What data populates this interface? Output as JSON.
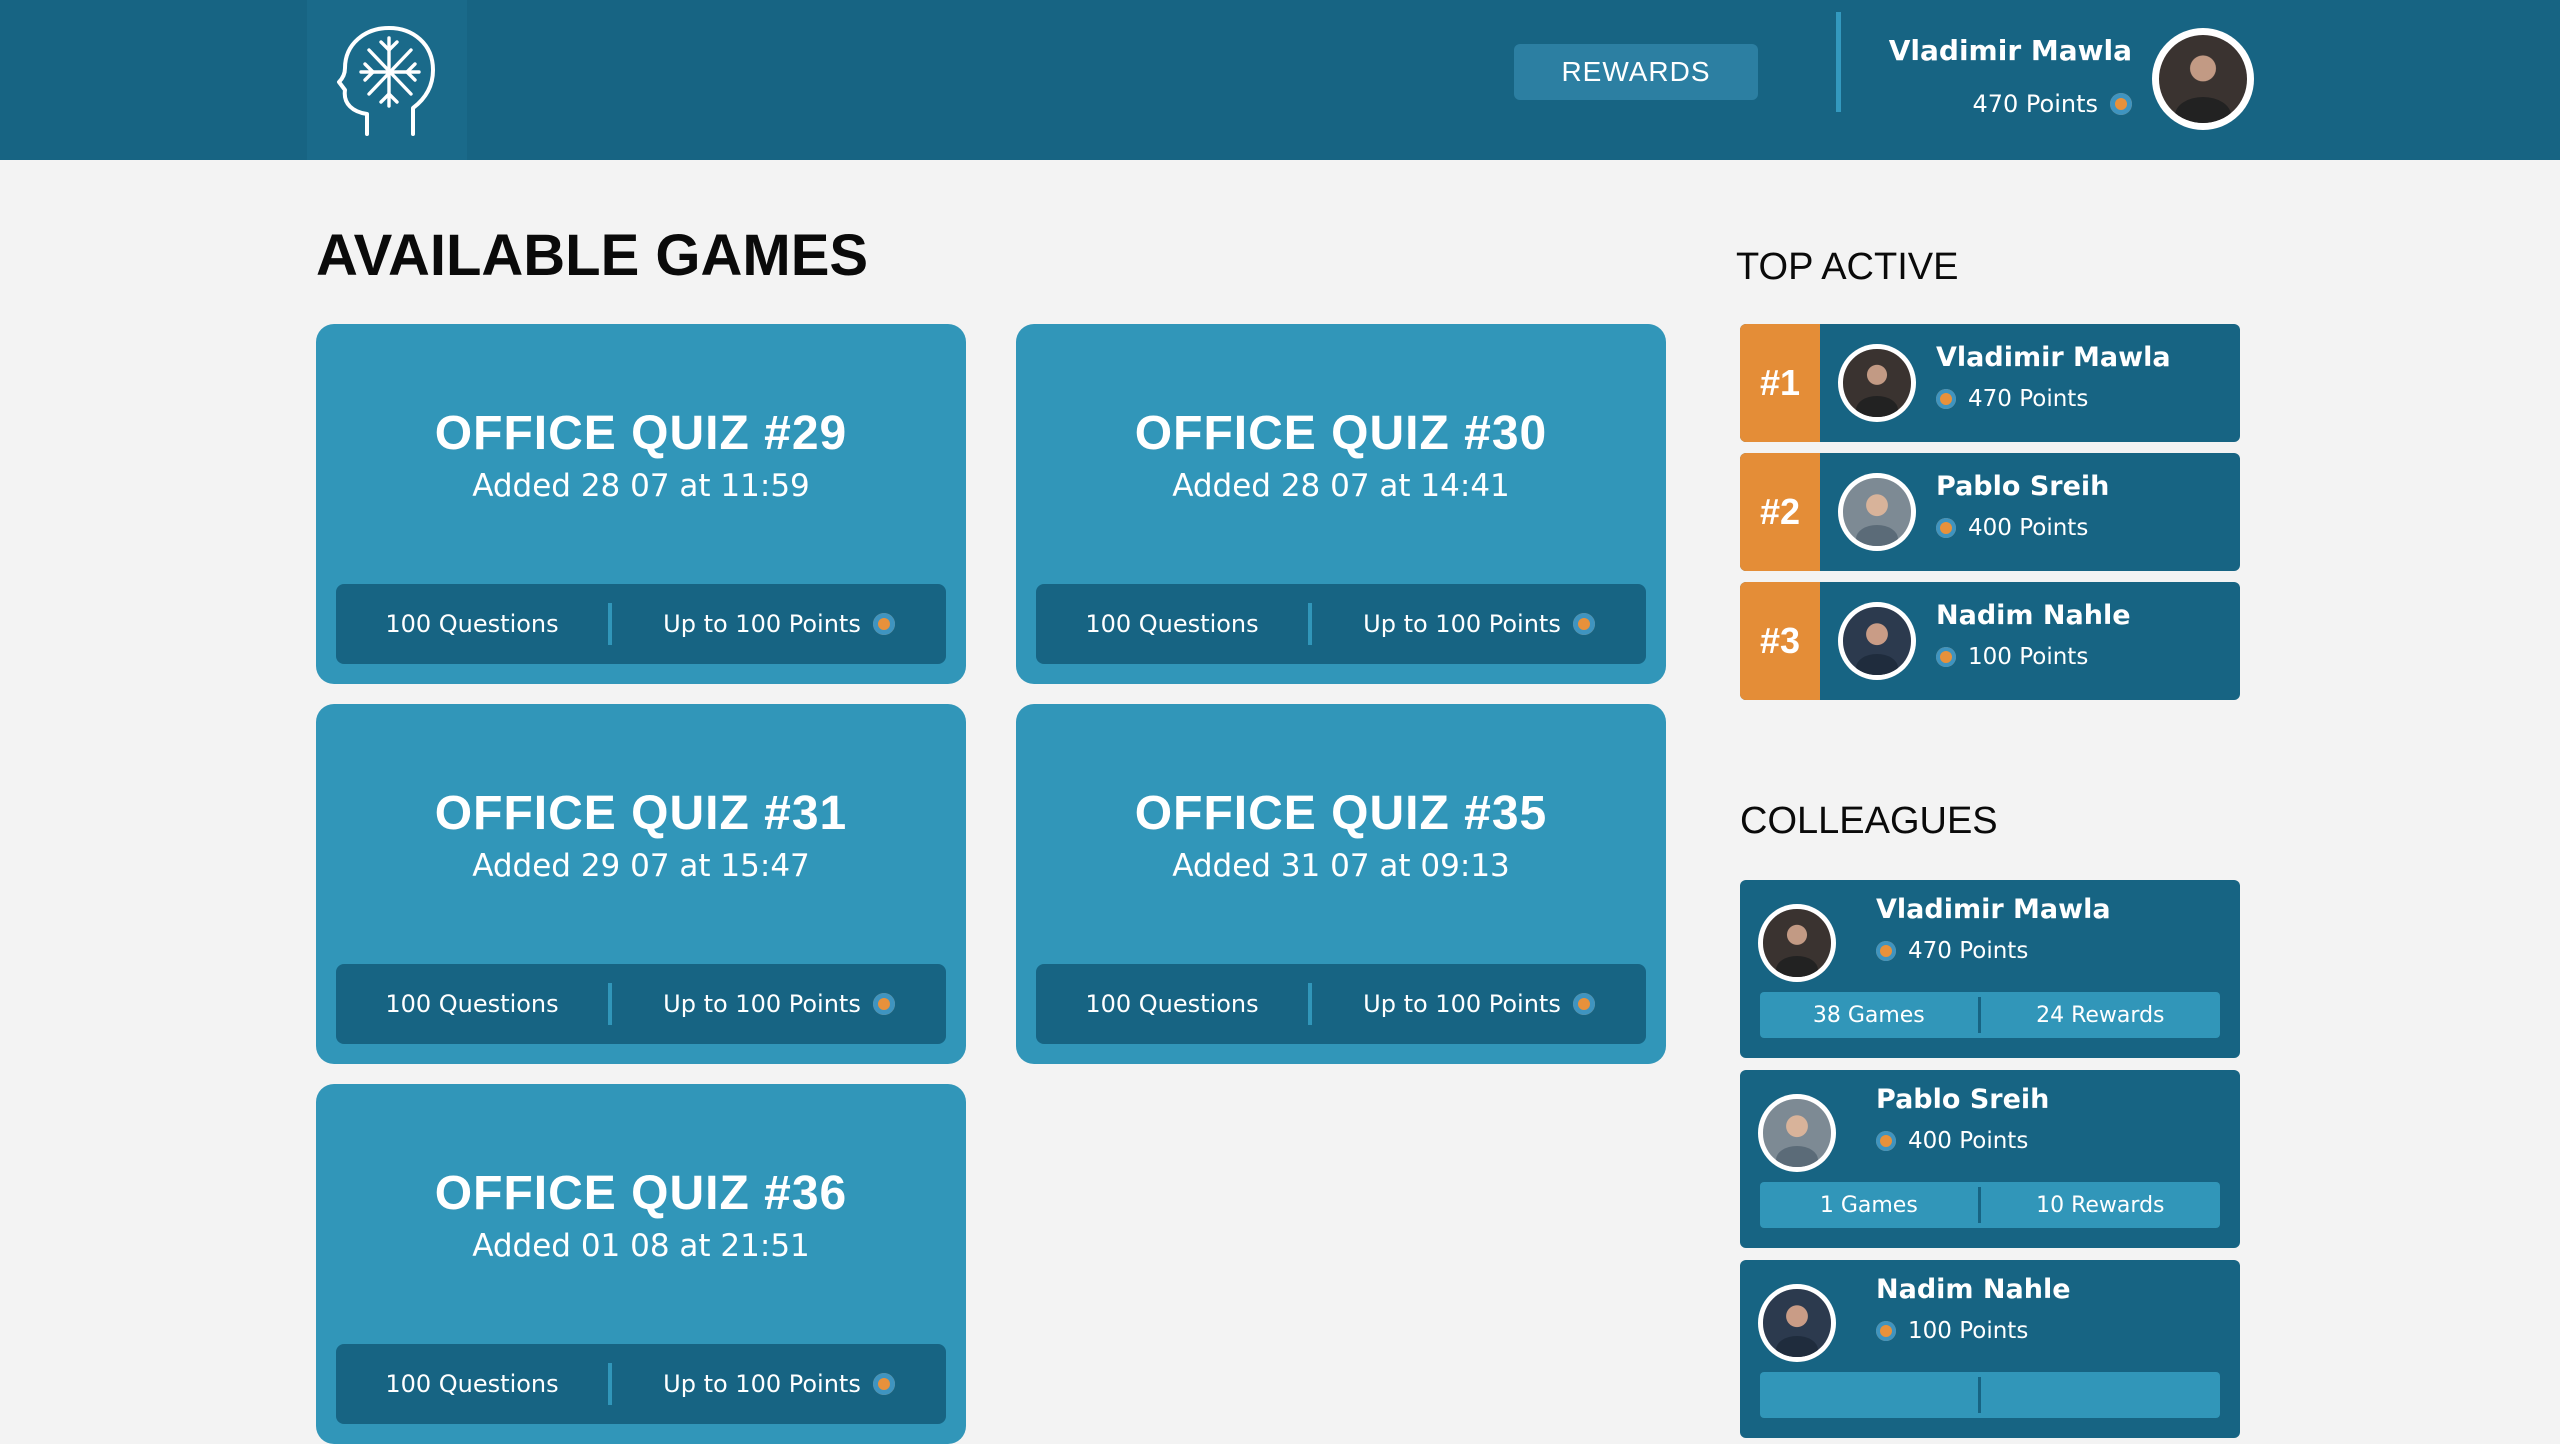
{
  "header": {
    "logo_icon": "brain-head-icon",
    "rewards_label": "REWARDS",
    "user_name": "Vladimir Mawla",
    "user_points": "470 Points"
  },
  "games_section": {
    "title": "AVAILABLE GAMES",
    "games": [
      {
        "title": "OFFICE QUIZ #29",
        "date": "Added 28 07 at 11:59",
        "questions": "100 Questions",
        "points": "Up to 100 Points"
      },
      {
        "title": "OFFICE QUIZ #30",
        "date": "Added 28 07 at 14:41",
        "questions": "100 Questions",
        "points": "Up to 100 Points"
      },
      {
        "title": "OFFICE QUIZ #31",
        "date": "Added 29 07 at 15:47",
        "questions": "100 Questions",
        "points": "Up to 100 Points"
      },
      {
        "title": "OFFICE QUIZ #35",
        "date": "Added 31 07 at 09:13",
        "questions": "100 Questions",
        "points": "Up to 100 Points"
      },
      {
        "title": "OFFICE QUIZ #36",
        "date": "Added 01 08 at 21:51",
        "questions": "100 Questions",
        "points": "Up to 100 Points"
      }
    ]
  },
  "top_active": {
    "title": "TOP ACTIVE",
    "items": [
      {
        "rank": "#1",
        "name": "Vladimir Mawla",
        "points": "470 Points"
      },
      {
        "rank": "#2",
        "name": "Pablo Sreih",
        "points": "400 Points"
      },
      {
        "rank": "#3",
        "name": "Nadim Nahle",
        "points": "100 Points"
      }
    ]
  },
  "colleagues": {
    "title": "COLLEAGUES",
    "items": [
      {
        "name": "Vladimir Mawla",
        "points": "470 Points",
        "games": "38 Games",
        "rewards": "24 Rewards"
      },
      {
        "name": "Pablo Sreih",
        "points": "400 Points",
        "games": "1 Games",
        "rewards": "10 Rewards"
      },
      {
        "name": "Nadim Nahle",
        "points": "100 Points",
        "games": "",
        "rewards": ""
      }
    ]
  },
  "colors": {
    "header_bg": "#176483",
    "card_bg": "#3196b9",
    "rank_accent": "#e48d37",
    "page_bg": "#f3f3f3"
  }
}
